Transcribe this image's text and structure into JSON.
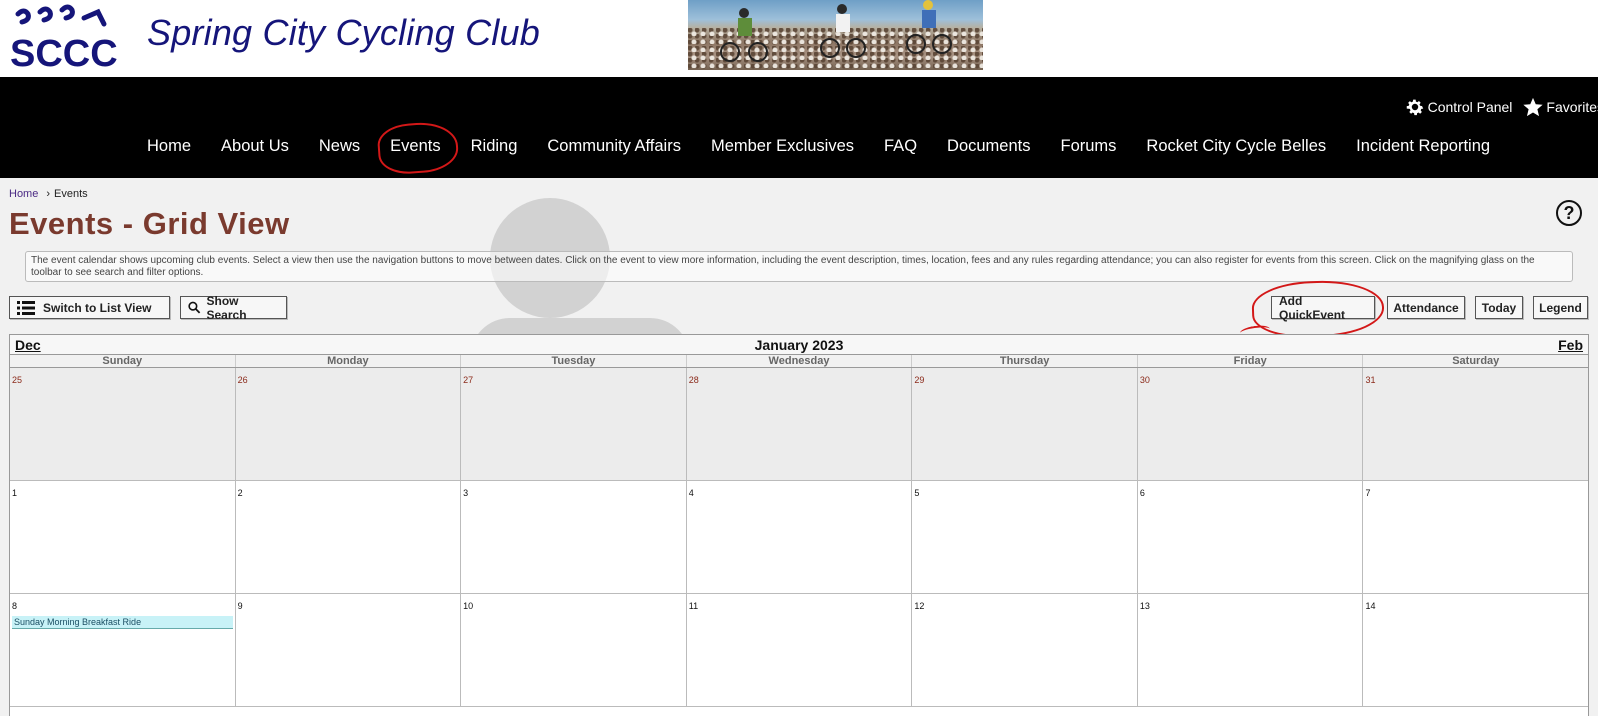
{
  "header": {
    "logo_text": "SCCC",
    "site_title": "Spring City Cycling Club"
  },
  "nav": {
    "utility": [
      {
        "label": "Control Panel",
        "icon": "gear-icon"
      },
      {
        "label": "Favorites",
        "icon": "star-icon"
      }
    ],
    "menu": [
      "Home",
      "About Us",
      "News",
      "Events",
      "Riding",
      "Community Affairs",
      "Member Exclusives",
      "FAQ",
      "Documents",
      "Forums",
      "Rocket City Cycle Belles",
      "Incident Reporting"
    ]
  },
  "breadcrumb": {
    "home": "Home",
    "current": "Events"
  },
  "page": {
    "title": "Events - Grid View",
    "help": "?",
    "description": "The event calendar shows upcoming club events. Select a view then use the navigation buttons to move between dates. Click on the event to view more information, including the event description, times, location, fees and any rules regarding attendance; you can also register for events from this screen. Click on the magnifying glass on the toolbar to see search and filter options."
  },
  "toolbar": {
    "list_view": "Switch to List View",
    "show_search": "Show Search",
    "add_quickevent": "Add QuickEvent",
    "attendance": "Attendance",
    "today": "Today",
    "legend": "Legend"
  },
  "calendar": {
    "prev": "Dec",
    "next": "Feb",
    "month": "January 2023",
    "days_of_week": [
      "Sunday",
      "Monday",
      "Tuesday",
      "Wednesday",
      "Thursday",
      "Friday",
      "Saturday"
    ],
    "weeks": [
      [
        {
          "n": "25",
          "other": true
        },
        {
          "n": "26",
          "other": true
        },
        {
          "n": "27",
          "other": true
        },
        {
          "n": "28",
          "other": true
        },
        {
          "n": "29",
          "other": true
        },
        {
          "n": "30",
          "other": true
        },
        {
          "n": "31",
          "other": true
        }
      ],
      [
        {
          "n": "1"
        },
        {
          "n": "2"
        },
        {
          "n": "3"
        },
        {
          "n": "4"
        },
        {
          "n": "5"
        },
        {
          "n": "6"
        },
        {
          "n": "7"
        }
      ],
      [
        {
          "n": "8",
          "event": "Sunday Morning Breakfast Ride"
        },
        {
          "n": "9"
        },
        {
          "n": "10"
        },
        {
          "n": "11"
        },
        {
          "n": "12"
        },
        {
          "n": "13"
        },
        {
          "n": "14"
        }
      ]
    ]
  },
  "colors": {
    "title_blue": "#15157a",
    "page_title": "#7a3a2e",
    "annotation_red": "#d31818",
    "event_bg": "#c8f2f7"
  }
}
